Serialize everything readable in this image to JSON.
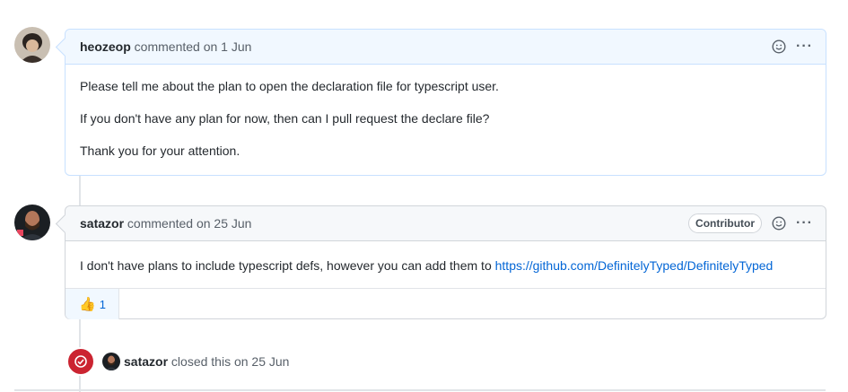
{
  "comments": [
    {
      "author": "heozeop",
      "meta": "commented on 1 Jun",
      "paragraphs": [
        "Please tell me about the plan to open the declaration file for typescript user.",
        "If you don't have any plan for now, then can I pull request the declare file?",
        "Thank you for your attention."
      ]
    },
    {
      "author": "satazor",
      "meta": "commented on 25 Jun",
      "badge": "Contributor",
      "body_text": "I don't have plans to include typescript defs, however you can add them to ",
      "link": "https://github.com/DefinitelyTyped/DefinitelyTyped",
      "reaction_emoji": "👍",
      "reaction_count": "1"
    }
  ],
  "event": {
    "actor": "satazor",
    "text": "closed this on 25 Jun"
  },
  "icons": [
    "smiley-icon",
    "kebab-menu-icon",
    "closed-issue-icon",
    "thumbs-up-icon"
  ],
  "colors": {
    "accent": "#0366d6",
    "closed": "#cb2431",
    "header_blue": "#f1f8ff",
    "border_blue": "#c8e1ff"
  }
}
